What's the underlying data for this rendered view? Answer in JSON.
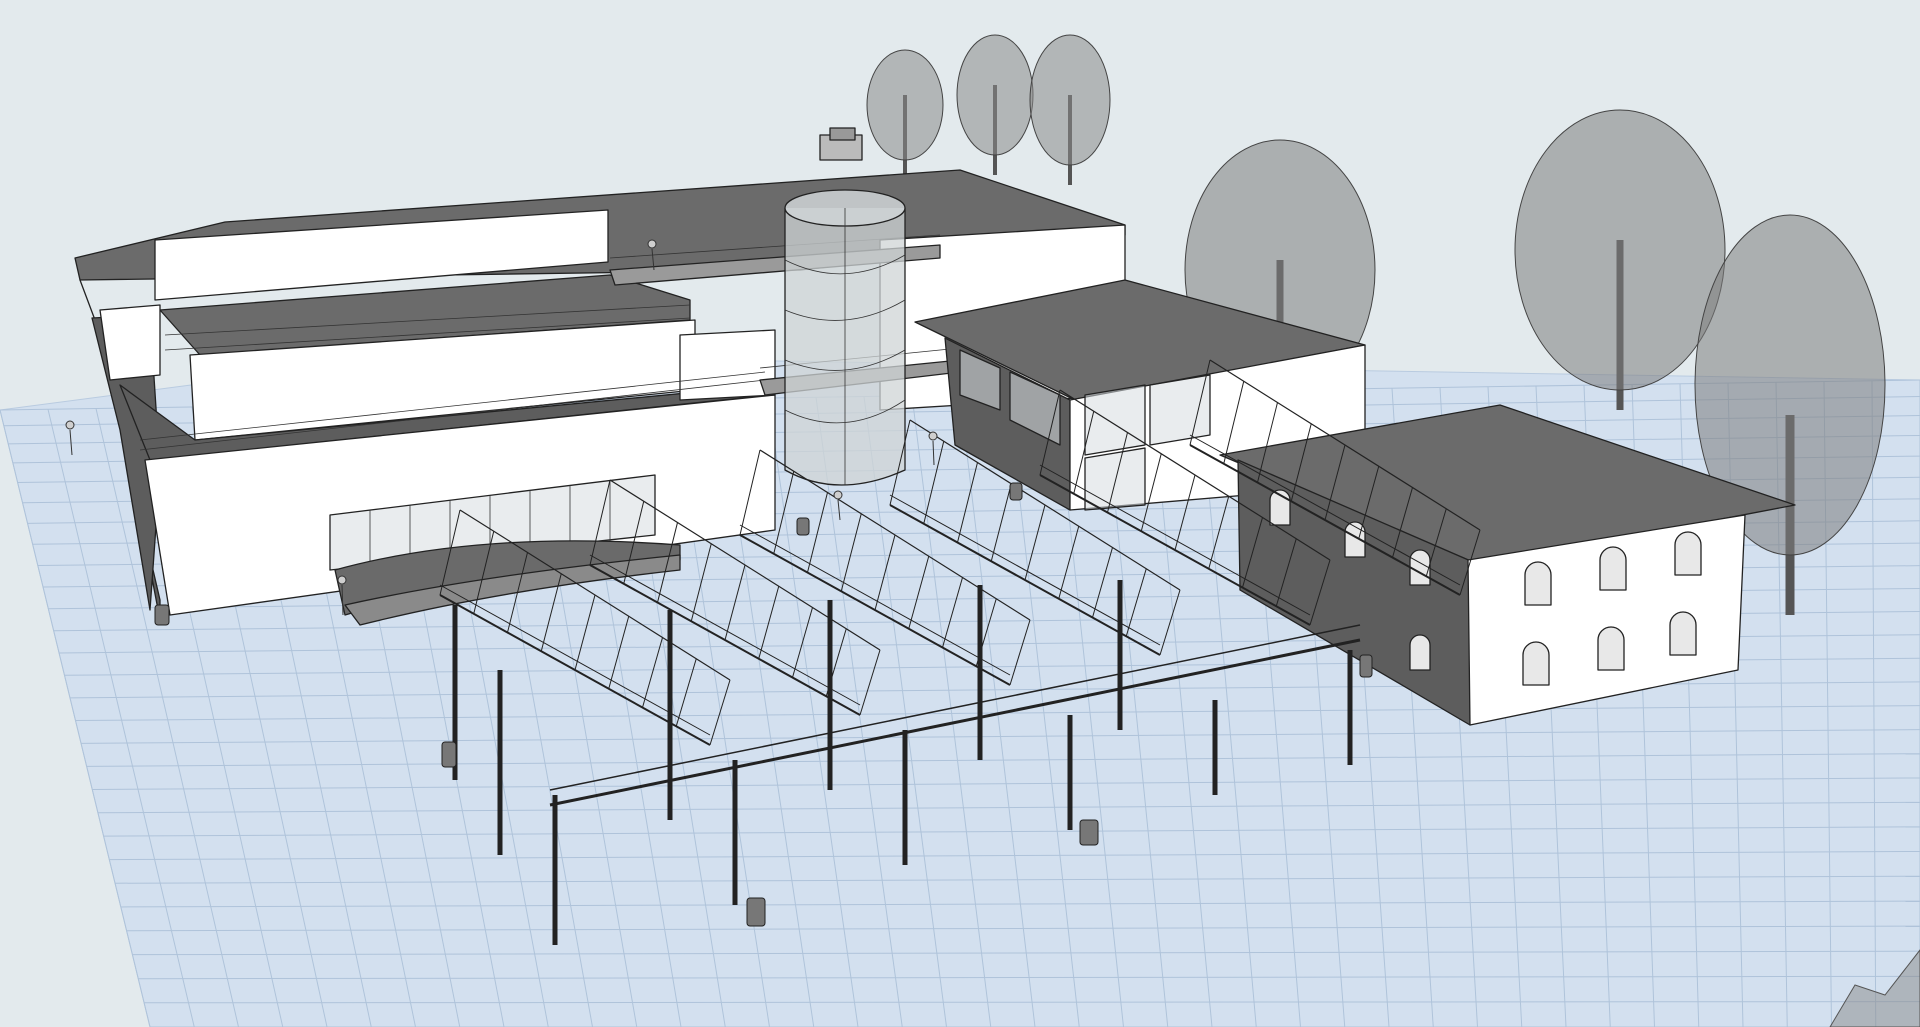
{
  "viewport": {
    "background_color": "#e3eaed",
    "ground_color": "#d3e0ef",
    "grid_color": "#a9bed6",
    "roof_color": "#6b6b6b",
    "wall_color": "#ffffff",
    "line_color": "#222222"
  },
  "objects": {
    "main_building": "main-hall-building",
    "stair_tower": "spiral-stair-tower",
    "two_story_pavilion": "glass-pavilion",
    "villa": "villa-with-hip-roof",
    "canopy": "truss-canopy-structure",
    "trees": "tree-icon",
    "people": "person-figure-icon",
    "bins": "trash-bin-icon"
  },
  "counts": {
    "canopy_bays": 6,
    "villa_windows_front": 6,
    "villa_windows_side": 4
  }
}
